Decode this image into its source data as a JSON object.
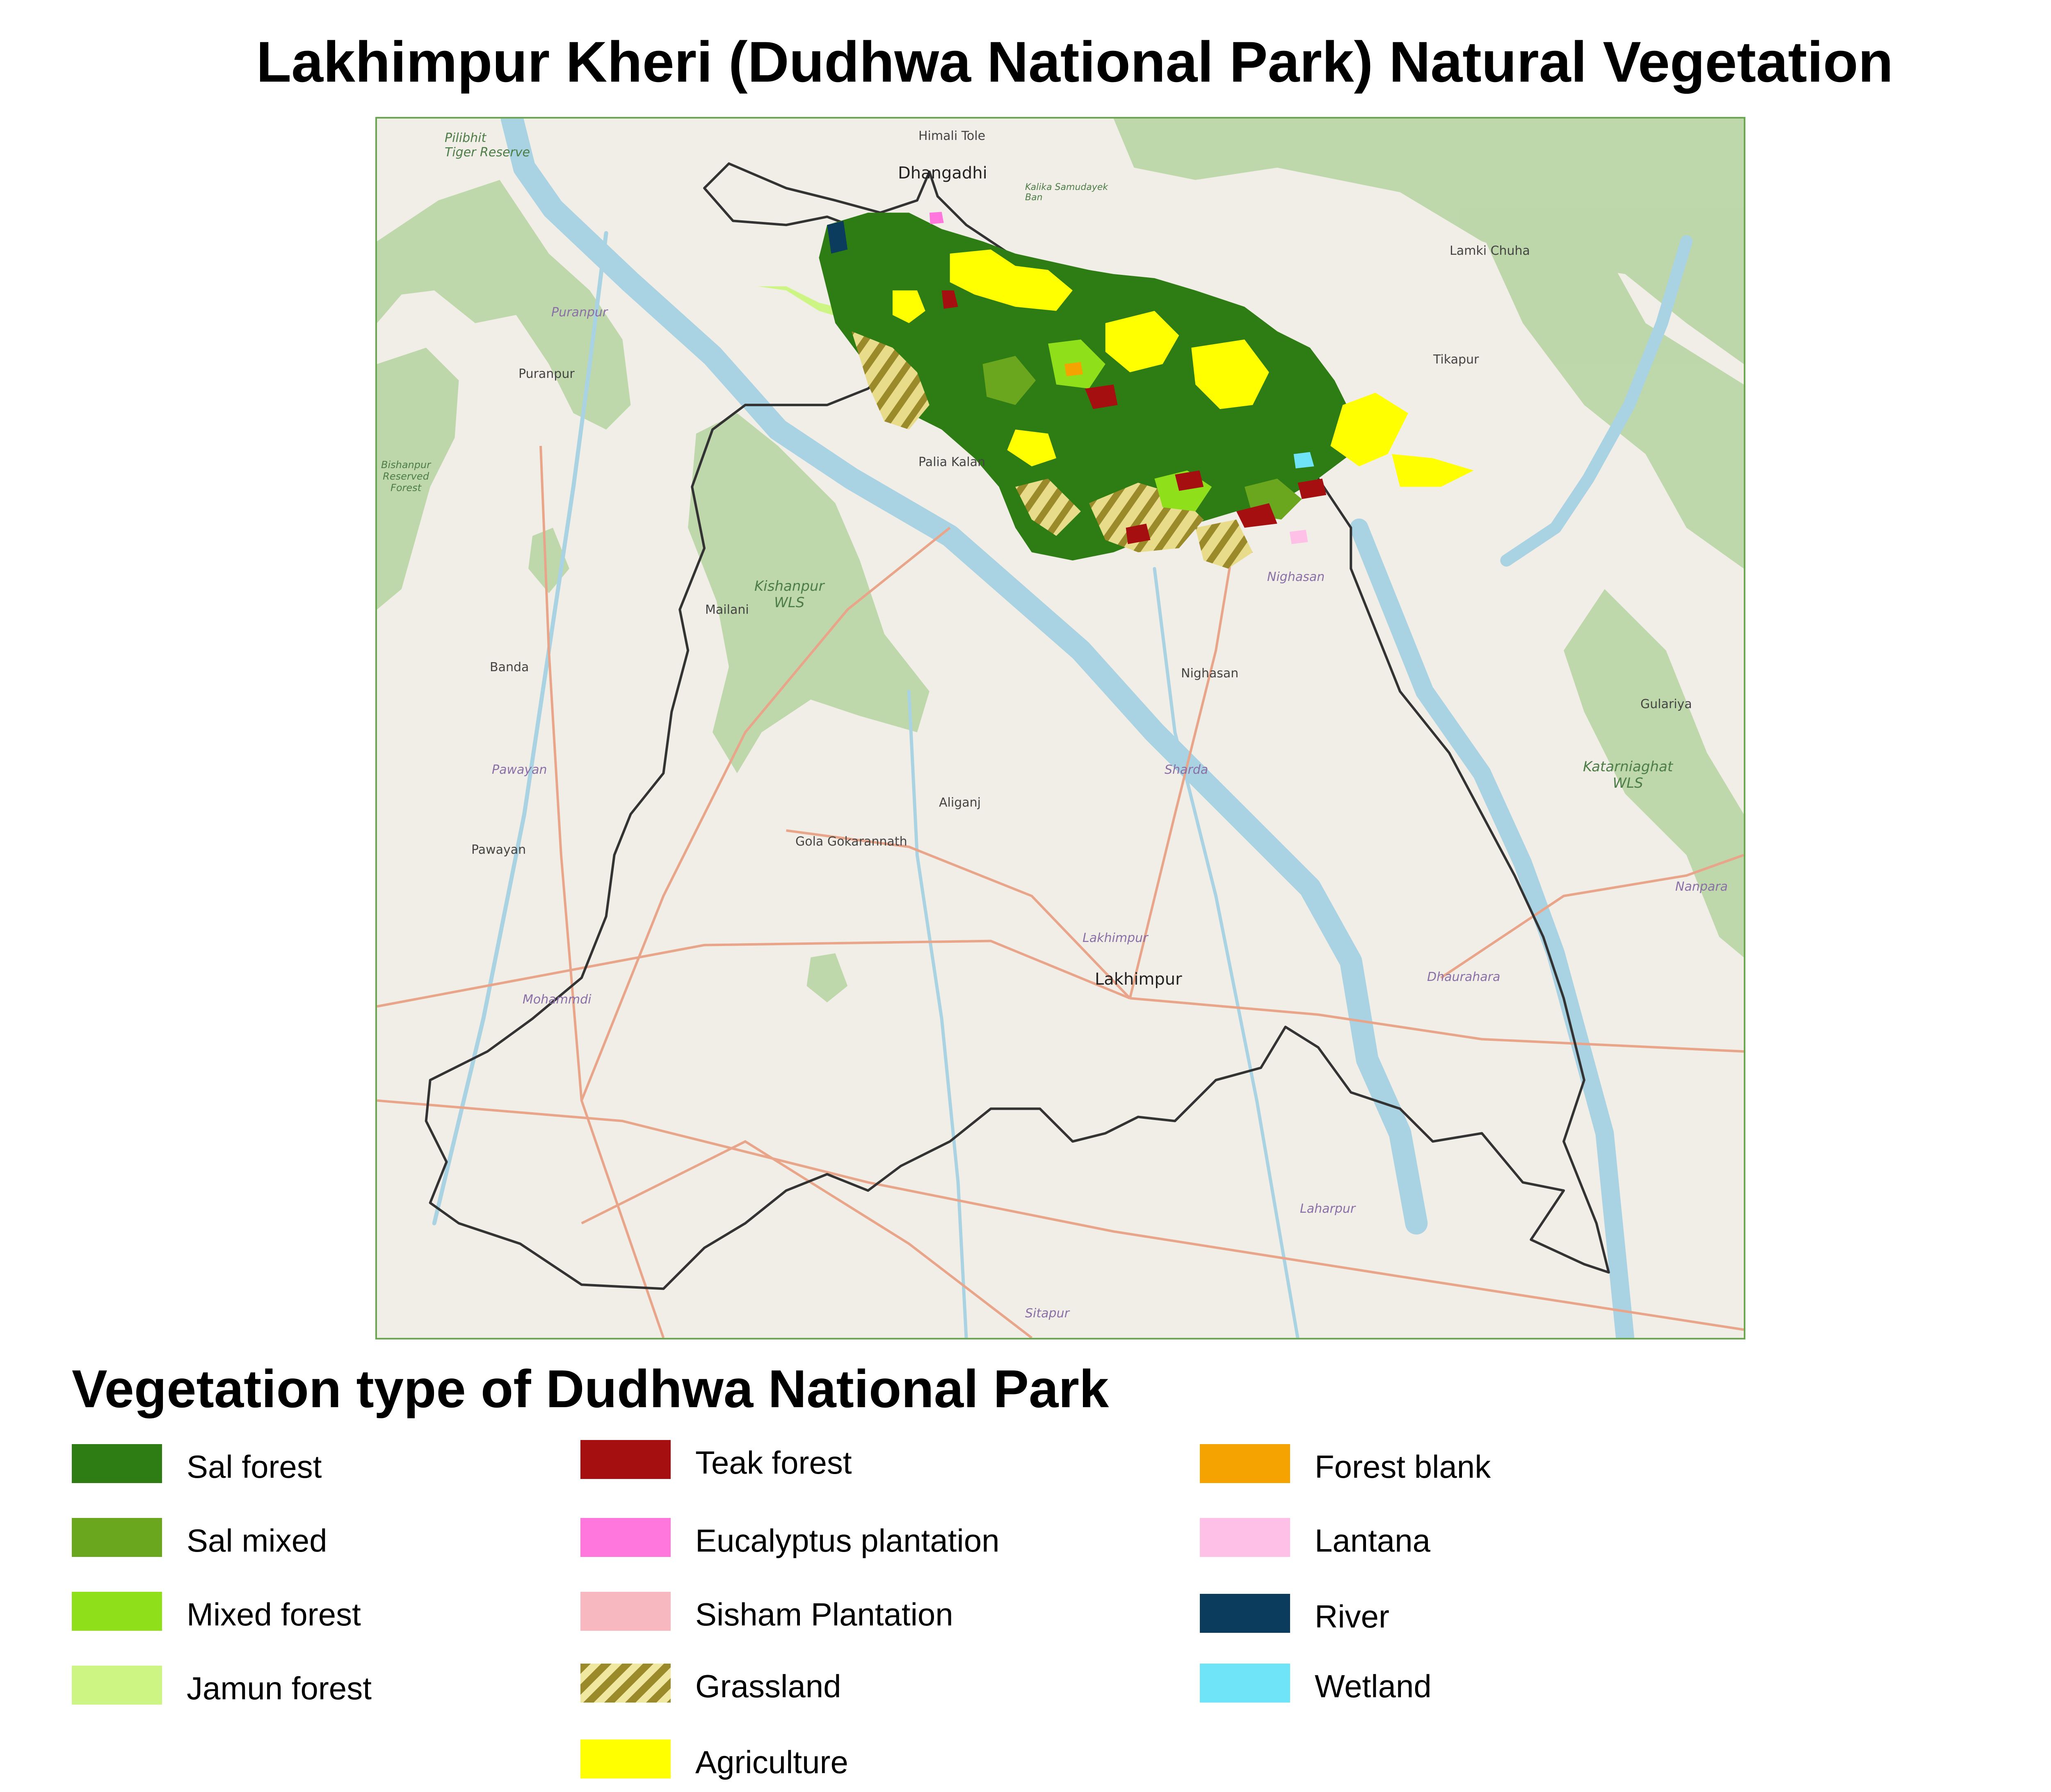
{
  "title": "Lakhimpur Kheri (Dudhwa National Park) Natural Vegetation",
  "map": {
    "places": {
      "pilibhit_tiger_reserve": "Pilibhit\nTiger Reserve",
      "himali_tole": "Himali Tole",
      "dhangadhi": "Dhangadhi",
      "kailali_ban": "Kalika Samudayek\nBan",
      "lamki_chuha": "Lamki Chuha",
      "puranpur_it": "Puranpur",
      "puranpur": "Puranpur",
      "tikapur": "Tikapur",
      "bishanpur": "Bishanpur\nReserved\nForest",
      "palia_kalan": "Palia Kalan",
      "kishanpur_wls": "Kishanpur\nWLS",
      "mailani": "Mailani",
      "nighasan_it": "Nighasan",
      "nighasan": "Nighasan",
      "banda": "Banda",
      "gulariya": "Gulariya",
      "pawayan_it": "Pawayan",
      "sharda": "Sharda",
      "katarniaghat": "Katarniaghat\nWLS",
      "aliganj": "Aliganj",
      "gola": "Gola Gokarannath",
      "pawayan": "Pawayan",
      "nanpara": "Nanpara",
      "lakhimpur_it": "Lakhimpur",
      "lakhimpur": "Lakhimpur",
      "dhaurahara": "Dhaurahara",
      "mohammdi": "Mohammdi",
      "laharpur": "Laharpur",
      "sitapur": "Sitapur"
    }
  },
  "legend": {
    "title": "Vegetation type of Dudhwa National Park",
    "items": [
      {
        "label": "Sal forest",
        "color": "#2e7d14"
      },
      {
        "label": "Sal mixed",
        "color": "#6aa61e"
      },
      {
        "label": "Mixed forest",
        "color": "#8fe01a"
      },
      {
        "label": "Jamun forest",
        "color": "#ccf583"
      },
      {
        "label": "Teak forest",
        "color": "#a50f0f"
      },
      {
        "label": "Eucalyptus plantation",
        "color": "#ff77dd"
      },
      {
        "label": "Sisham Plantation",
        "color": "#f8b8c0"
      },
      {
        "label": "Grassland",
        "color": "#c9b93a"
      },
      {
        "label": "Agriculture",
        "color": "#ffff00"
      },
      {
        "label": "Forest blank",
        "color": "#f5a300"
      },
      {
        "label": "Lantana",
        "color": "#ffc0e8"
      },
      {
        "label": "River",
        "color": "#0b3c5d"
      },
      {
        "label": "Wetland",
        "color": "#6fe3f8"
      }
    ]
  }
}
